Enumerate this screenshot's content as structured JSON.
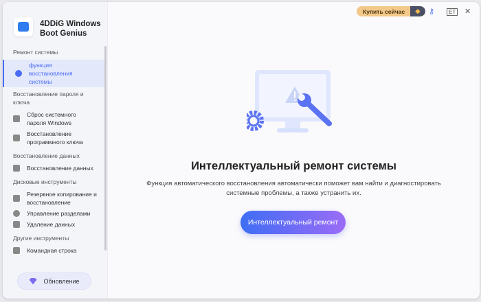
{
  "app": {
    "name": "4DDiG Windows Boot Genius"
  },
  "topbar": {
    "buy_label": "Купить сейчас"
  },
  "sidebar": {
    "sections": [
      {
        "title": "Ремонт системы",
        "items": [
          {
            "label": "функция восстановления системы",
            "icon": "wrench-icon"
          }
        ]
      },
      {
        "title": "Восстановление пароля и ключа",
        "items": [
          {
            "label": "Сброс системного пароля Windows",
            "icon": "lock-icon"
          },
          {
            "label": "Восстановление программного ключа",
            "icon": "key-doc-icon"
          }
        ]
      },
      {
        "title": "Восстановление данных",
        "items": [
          {
            "label": "Восстановление данных",
            "icon": "chart-icon"
          }
        ]
      },
      {
        "title": "Дисковые инструменты",
        "items": [
          {
            "label": "Резервное копирование и восстановление",
            "icon": "folder-icon"
          },
          {
            "label": "Управление разделами",
            "icon": "pie-icon"
          },
          {
            "label": "Удаление данных",
            "icon": "trash-icon"
          }
        ]
      },
      {
        "title": "Другие инструменты",
        "items": [
          {
            "label": "Командная строка",
            "icon": "terminal-icon"
          }
        ]
      }
    ],
    "update_label": "Обновление"
  },
  "main": {
    "title": "Интеллектуальный ремонт системы",
    "description": "Функция автоматического восстановления автоматически поможет вам найти и диагностировать системные проблемы, а также устранить их.",
    "button_label": "Интеллектуальный ремонт"
  }
}
